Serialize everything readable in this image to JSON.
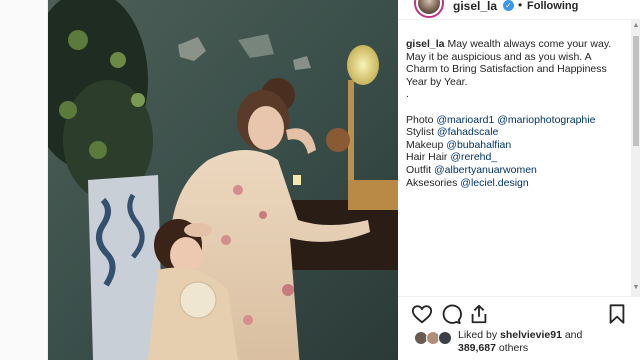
{
  "header": {
    "username": "gisel_la",
    "separator": "•",
    "follow_status": "Following"
  },
  "caption": {
    "username": "gisel_la",
    "lines": [
      " May wealth always come your way.",
      "May it be auspicious and as you wish. A",
      "Charm to Bring Satisfaction and Happiness",
      "Year by Year.",
      "."
    ],
    "credits": [
      {
        "label": "Photo ",
        "handles": [
          "@marioard1",
          "@mariophotographie"
        ]
      },
      {
        "label": "Stylist ",
        "handles": [
          "@fahadscale"
        ]
      },
      {
        "label": "Makeup ",
        "handles": [
          "@bubahalfian"
        ]
      },
      {
        "label": "Hair Hair ",
        "handles": [
          "@rerehd_"
        ]
      },
      {
        "label": "Outfit ",
        "handles": [
          "@albertyanuarwomen"
        ]
      },
      {
        "label": "Aksesories ",
        "handles": [
          "@leciel.design"
        ]
      }
    ]
  },
  "likes": {
    "prefix": "Liked by ",
    "user": "shelvievie91",
    "joiner": " and",
    "count": "389,687",
    "suffix": " others"
  },
  "icons": {
    "like": "heart-icon",
    "comment": "comment-icon",
    "share": "share-icon",
    "save": "bookmark-icon",
    "verified": "verified-badge-icon"
  },
  "colors": {
    "link": "#003569",
    "verified": "#3897f0",
    "story_ring": "#c13584"
  }
}
